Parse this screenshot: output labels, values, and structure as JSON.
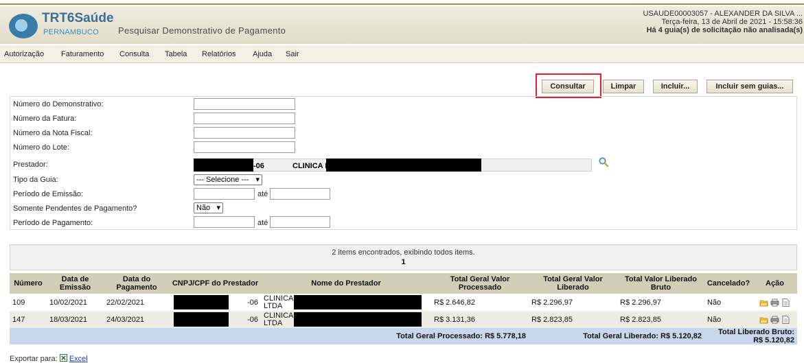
{
  "header": {
    "logo_title": "TRT6Saúde",
    "logo_sub": "PERNAMBUCO",
    "page_title": "Pesquisar Demonstrativo de Pagamento",
    "user_line": "USAUDE00003057 - ALEXANDER DA SILVA ...",
    "date_line": "Terça-feira, 13 de Abril de 2021 - 15:58:36",
    "alert_line": "Há 4 guia(s) de solicitação não analisada(s)"
  },
  "menu": [
    "Autorização",
    "Faturamento",
    "Consulta",
    "Tabela",
    "Relatórios",
    "Ajuda",
    "Sair"
  ],
  "buttons": {
    "consultar": "Consultar",
    "limpar": "Limpar",
    "incluir": "Incluir...",
    "incluir_sem_guias": "Incluir sem guias..."
  },
  "form": {
    "numero_demonstrativo": "Número do Demonstrativo:",
    "numero_fatura": "Número da Fatura:",
    "numero_nota_fiscal": "Número da Nota Fiscal:",
    "numero_lote": "Número do Lote:",
    "prestador": "Prestador:",
    "prestador_code_suffix": "-06",
    "prestador_name_prefix": "CLINICA F",
    "tipo_guia": "Tipo da Guia:",
    "tipo_guia_value": "--- Selecione ---",
    "periodo_emissao": "Período de Emissão:",
    "somente_pendentes": "Somente Pendentes de Pagamento?",
    "somente_pendentes_value": "Não",
    "periodo_pagamento": "Período de Pagamento:",
    "ate": "até"
  },
  "results": {
    "summary": "2 items encontrados, exibindo todos items.",
    "page": "1"
  },
  "table": {
    "headers": [
      "Número",
      "Data de Emissão",
      "Data do Pagamento",
      "CNPJ/CPF do Prestador",
      "Nome do Prestador",
      "Total Geral Valor Processado",
      "Total Geral Valor Liberado",
      "Total Valor Liberado Bruto",
      "Cancelado?",
      "Ação"
    ],
    "rows": [
      {
        "numero": "109",
        "emissao": "10/02/2021",
        "pagamento": "22/02/2021",
        "cnpj_suffix": "-06",
        "nome": "CLINICA LTDA",
        "processado": "R$ 2.646,82",
        "liberado": "R$ 2.296,97",
        "bruto": "R$ 2.296,97",
        "cancelado": "Não"
      },
      {
        "numero": "147",
        "emissao": "18/03/2021",
        "pagamento": "24/03/2021",
        "cnpj_suffix": "-06",
        "nome": "CLINICA LTDA",
        "processado": "R$ 3.131,36",
        "liberado": "R$ 2.823,85",
        "bruto": "R$ 2.823,85",
        "cancelado": "Não"
      }
    ],
    "totals": {
      "processado": "Total Geral Processado: R$ 5.778,18",
      "liberado": "Total Geral Liberado: R$ 5.120,82",
      "bruto": "Total Liberado Bruto: R$ 5.120,82"
    }
  },
  "export": {
    "label": "Exportar para:",
    "excel": "Excel"
  }
}
